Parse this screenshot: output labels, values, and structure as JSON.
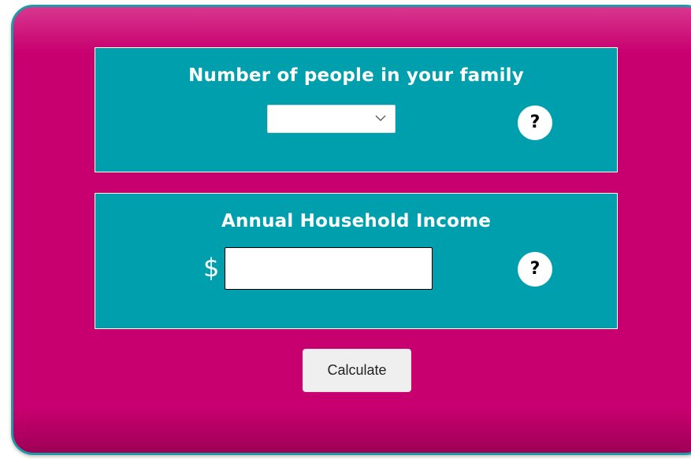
{
  "family_panel": {
    "title": "Number of people in your family",
    "select_value": "",
    "help_label": "?"
  },
  "income_panel": {
    "title": "Annual Household Income",
    "currency_symbol": "$",
    "input_value": "",
    "help_label": "?"
  },
  "calculate_label": "Calculate",
  "colors": {
    "card_background": "#c8006f",
    "card_border": "#1e9aa6",
    "panel_background": "#009fae",
    "panel_border": "#ffffff",
    "button_background": "#efefef"
  },
  "icons": {
    "select_arrow": "chevron-down-icon",
    "help": "question-mark-icon"
  }
}
